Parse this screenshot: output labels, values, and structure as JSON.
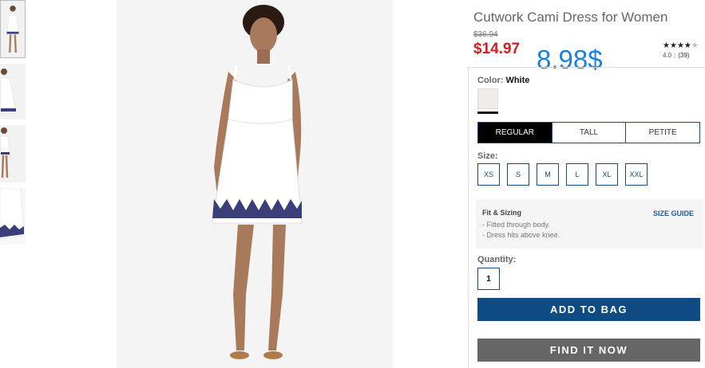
{
  "product": {
    "title": "Cutwork Cami Dress for Women",
    "original_price": "$36.94",
    "sale_price": "$14.97",
    "overlay_price": "8.98$",
    "rating": {
      "stars_filled": 4,
      "stars_total": 5,
      "score": "4.0",
      "count": "(39)"
    }
  },
  "color": {
    "label": "Color:",
    "value": "White",
    "swatch_color": "#f0ecea"
  },
  "fit_tabs": [
    "REGULAR",
    "TALL",
    "PETITE"
  ],
  "size": {
    "label": "Size:",
    "options": [
      "XS",
      "S",
      "M",
      "L",
      "XL",
      "XXL"
    ]
  },
  "fit_sizing": {
    "title": "Fit & Sizing",
    "guide_link": "SIZE GUIDE",
    "items": [
      "- Fitted through body.",
      "- Dress hits above knee."
    ]
  },
  "quantity": {
    "label": "Quantity:",
    "value": "1"
  },
  "buttons": {
    "add_to_bag": "ADD TO BAG",
    "find_it_now": "FIND IT NOW"
  },
  "colors": {
    "brand_blue": "#0f4c84",
    "sale_red": "#d21f1f",
    "overlay_blue": "#1b7fe0",
    "find_gray": "#666666"
  },
  "icons": [
    "star-icon"
  ]
}
